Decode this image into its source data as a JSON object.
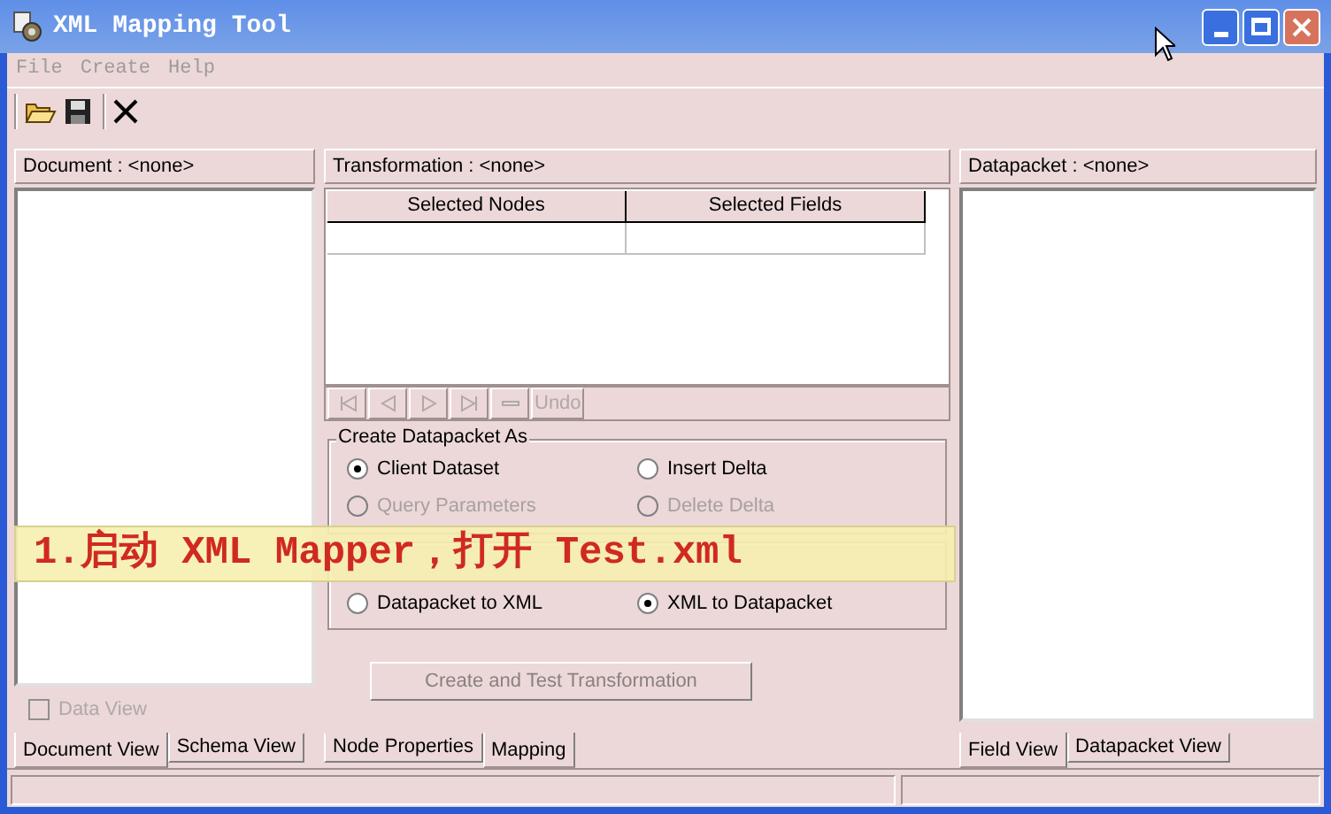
{
  "window": {
    "title": "XML Mapping Tool"
  },
  "menu": [
    {
      "label": "File"
    },
    {
      "label": "Create"
    },
    {
      "label": "Help"
    }
  ],
  "document_panel": {
    "header": "Document : <none>",
    "data_view": {
      "label": "Data View",
      "checked": false,
      "disabled": true
    },
    "tabs": [
      {
        "label": "Document View",
        "selected": true
      },
      {
        "label": "Schema View",
        "selected": false
      }
    ]
  },
  "transformation_panel": {
    "header": "Transformation : <none>",
    "columns": [
      "Selected Nodes",
      "Selected Fields"
    ],
    "undo_button": {
      "label": "Undo",
      "disabled": true
    },
    "create_group": {
      "title": "Create Datapacket As",
      "options": [
        {
          "label": "Client Dataset",
          "selected": true,
          "disabled": false
        },
        {
          "label": "Insert Delta",
          "selected": false,
          "disabled": false
        },
        {
          "label": "Query Parameters",
          "selected": false,
          "disabled": true
        },
        {
          "label": "Delete Delta",
          "selected": false,
          "disabled": true
        }
      ]
    },
    "direction_group": {
      "options": [
        {
          "label": "Datapacket to XML",
          "selected": false
        },
        {
          "label": "XML to Datapacket",
          "selected": true
        }
      ]
    },
    "create_button": {
      "label": "Create and Test Transformation",
      "disabled": true
    },
    "tabs": [
      {
        "label": "Node Properties",
        "selected": false
      },
      {
        "label": "Mapping",
        "selected": true
      }
    ]
  },
  "datapacket_panel": {
    "header": "Datapacket : <none>",
    "tabs": [
      {
        "label": "Field View",
        "selected": true
      },
      {
        "label": "Datapacket View",
        "selected": false
      }
    ]
  },
  "annotation": {
    "text": "1.启动 XML Mapper，打开 Test.xml"
  }
}
